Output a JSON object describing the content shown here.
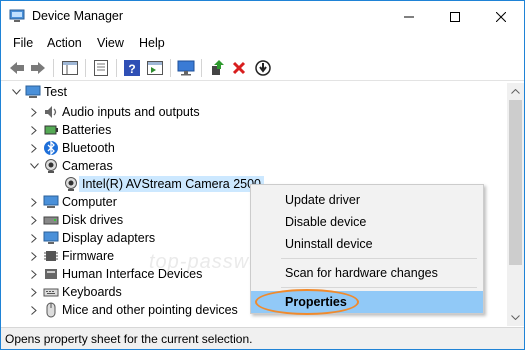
{
  "window": {
    "title": "Device Manager",
    "border_color": "#1f83d6",
    "icon": "device-manager-icon"
  },
  "menu": [
    "File",
    "Action",
    "View",
    "Help"
  ],
  "toolbar": {
    "buttons": [
      "back-icon",
      "forward-icon",
      "show-hide-console-tree-icon",
      "properties-icon",
      "help-icon",
      "action-pane-icon",
      "monitor-icon",
      "update-driver-icon",
      "uninstall-x-icon",
      "disable-device-icon"
    ]
  },
  "tree": {
    "root": "Test",
    "items": [
      {
        "label": "Audio inputs and outputs",
        "icon": "speaker-icon",
        "expanded": false
      },
      {
        "label": "Batteries",
        "icon": "battery-icon",
        "expanded": false
      },
      {
        "label": "Bluetooth",
        "icon": "bluetooth-icon",
        "expanded": false
      },
      {
        "label": "Cameras",
        "icon": "camera-icon",
        "expanded": true
      },
      {
        "label": "Intel(R) AVStream Camera 2500",
        "icon": "camera-icon",
        "child": true,
        "selected": true
      },
      {
        "label": "Computer",
        "icon": "computer-icon",
        "expanded": false
      },
      {
        "label": "Disk drives",
        "icon": "disk-drive-icon",
        "expanded": false
      },
      {
        "label": "Display adapters",
        "icon": "display-adapter-icon",
        "expanded": false
      },
      {
        "label": "Firmware",
        "icon": "firmware-icon",
        "expanded": false
      },
      {
        "label": "Human Interface Devices",
        "icon": "hid-icon",
        "expanded": false
      },
      {
        "label": "Keyboards",
        "icon": "keyboard-icon",
        "expanded": false
      },
      {
        "label": "Mice and other pointing devices",
        "icon": "mouse-icon",
        "expanded": false
      }
    ]
  },
  "context_menu": {
    "items": [
      "Update driver",
      "Disable device",
      "Uninstall device",
      "Scan for hardware changes",
      "Properties"
    ],
    "highlighted": "Properties",
    "highlight_color": "#91c9f7",
    "annotation_color": "#f08a2c"
  },
  "status": "Opens property sheet for the current selection.",
  "watermark": "top-password.com"
}
